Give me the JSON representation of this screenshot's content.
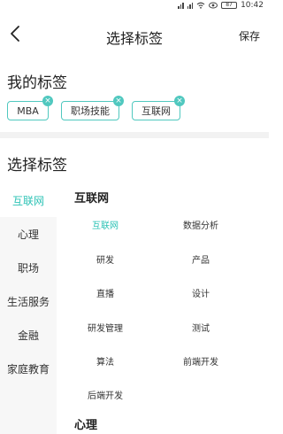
{
  "status_bar": {
    "battery": "87",
    "time": "10:42"
  },
  "header": {
    "title": "选择标签",
    "save_label": "保存"
  },
  "my_tags": {
    "title": "我的标签",
    "items": [
      {
        "label": "MBA"
      },
      {
        "label": "职场技能"
      },
      {
        "label": "互联网"
      }
    ]
  },
  "select_tags": {
    "title": "选择标签",
    "categories": [
      {
        "label": "互联网",
        "active": true
      },
      {
        "label": "心理"
      },
      {
        "label": "职场"
      },
      {
        "label": "生活服务"
      },
      {
        "label": "金融"
      },
      {
        "label": "家庭教育"
      }
    ],
    "groups": [
      {
        "title": "互联网",
        "items": [
          "互联网",
          "数据分析",
          "研发",
          "产品",
          "直播",
          "设计",
          "研发管理",
          "测试",
          "算法",
          "前端开发",
          "后端开发"
        ],
        "selected": "互联网"
      },
      {
        "title": "心理",
        "items": []
      }
    ]
  },
  "colors": {
    "accent": "#2ec3b6",
    "chip_border": "#50c8bf",
    "divider": "#f2f2f2",
    "sidebar_bg": "#f7f7f7"
  },
  "icons": {
    "back": "chevron-left-icon",
    "remove": "close-icon",
    "eye": "eye-icon",
    "wifi": "wifi-icon",
    "battery": "battery-icon"
  }
}
